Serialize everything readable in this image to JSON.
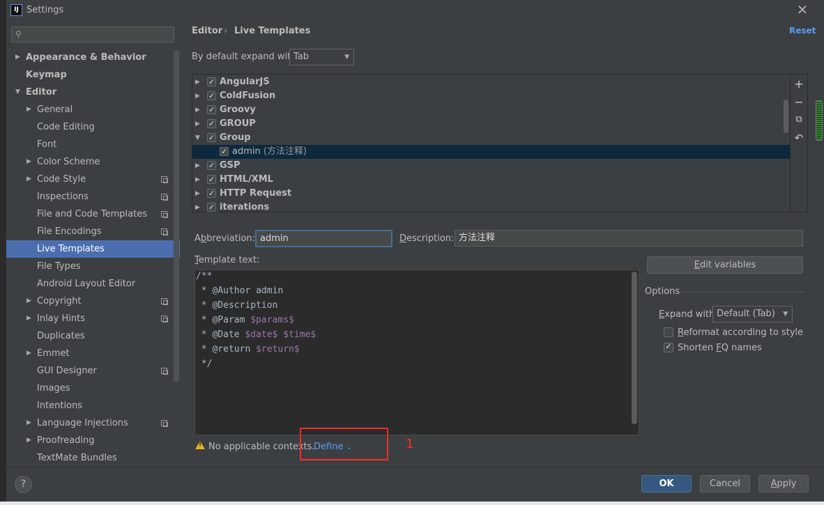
{
  "window": {
    "title": "Settings",
    "close": "✕",
    "app_icon": "IJ"
  },
  "sidebar": {
    "search_placeholder": "",
    "items": [
      {
        "label": "Appearance & Behavior",
        "arrow": "▶",
        "bold": true
      },
      {
        "label": "Keymap",
        "bold": true
      },
      {
        "label": "Editor",
        "arrow": "▼",
        "bold": true
      },
      {
        "label": "General",
        "arrow": "▶"
      },
      {
        "label": "Code Editing"
      },
      {
        "label": "Font"
      },
      {
        "label": "Color Scheme",
        "arrow": "▶"
      },
      {
        "label": "Code Style",
        "arrow": "▶",
        "project": true
      },
      {
        "label": "Inspections",
        "project": true
      },
      {
        "label": "File and Code Templates",
        "project": true
      },
      {
        "label": "File Encodings",
        "project": true
      },
      {
        "label": "Live Templates",
        "selected": true
      },
      {
        "label": "File Types"
      },
      {
        "label": "Android Layout Editor"
      },
      {
        "label": "Copyright",
        "arrow": "▶",
        "project": true
      },
      {
        "label": "Inlay Hints",
        "arrow": "▶",
        "project": true
      },
      {
        "label": "Duplicates"
      },
      {
        "label": "Emmet",
        "arrow": "▶"
      },
      {
        "label": "GUI Designer",
        "project": true
      },
      {
        "label": "Images"
      },
      {
        "label": "Intentions"
      },
      {
        "label": "Language Injections",
        "arrow": "▶",
        "project": true
      },
      {
        "label": "Proofreading",
        "arrow": "▶"
      },
      {
        "label": "TextMate Bundles"
      }
    ]
  },
  "breadcrumb": {
    "parent": "Editor",
    "separator": "›",
    "current": "Live Templates"
  },
  "reset_label": "Reset",
  "expand_default": {
    "label": "By default expand with",
    "value": "Tab"
  },
  "template_groups": [
    {
      "name": "AngularJS",
      "arrow": "▶",
      "checked": true
    },
    {
      "name": "ColdFusion",
      "arrow": "▶",
      "checked": true
    },
    {
      "name": "Groovy",
      "arrow": "▶",
      "checked": true
    },
    {
      "name": "GROUP",
      "arrow": "▶",
      "checked": true
    },
    {
      "name": "Group",
      "arrow": "▼",
      "checked": true
    },
    {
      "name": "admin",
      "desc": "(方法注释)",
      "checked": true,
      "child": true,
      "selected": true
    },
    {
      "name": "GSP",
      "arrow": "▶",
      "checked": true
    },
    {
      "name": "HTML/XML",
      "arrow": "▶",
      "checked": true
    },
    {
      "name": "HTTP Request",
      "arrow": "▶",
      "checked": true
    },
    {
      "name": "iterations",
      "arrow": "▶",
      "checked": true
    }
  ],
  "toolbar_icons": [
    "add-icon",
    "remove-icon",
    "copy-icon",
    "restore-icon"
  ],
  "abbreviation": {
    "label_pre": "A",
    "label_u": "b",
    "label_post": "breviation:",
    "value": "admin"
  },
  "description": {
    "label_u": "D",
    "label_post": "escription:",
    "value": "方法注释"
  },
  "template_text": {
    "label_u": "T",
    "label_post": "emplate text:",
    "lines": [
      "/**",
      " * @Author admin",
      " * @Description ",
      " * @Param $params$",
      " * @Date $date$ $time$",
      " * @return $return$",
      " */"
    ]
  },
  "edit_variables": {
    "label_u": "E",
    "label_post": "dit variables"
  },
  "options": {
    "title": "Options",
    "expand_with": {
      "label_u": "E",
      "label_post": "xpand with",
      "value": "Default (Tab)"
    },
    "reformat": {
      "label_u": "R",
      "label_post": "eformat according to style",
      "checked": false
    },
    "shorten": {
      "label_pre": "Shorten ",
      "label_u": "F",
      "label_post": "Q names",
      "checked": true
    }
  },
  "context": {
    "text": "No applicable contexts.",
    "define": "Define",
    "define_caret": "⌄"
  },
  "annotation": {
    "number": "1",
    "color": "#ff2a2a"
  },
  "buttons": {
    "help": "?",
    "ok": "OK",
    "cancel": "Cancel",
    "apply_u": "A",
    "apply_post": "pply"
  },
  "colors": {
    "accent": "#4b6eaf",
    "link": "#589df6",
    "selection": "#0d293e",
    "template_var": "#9876aa"
  }
}
